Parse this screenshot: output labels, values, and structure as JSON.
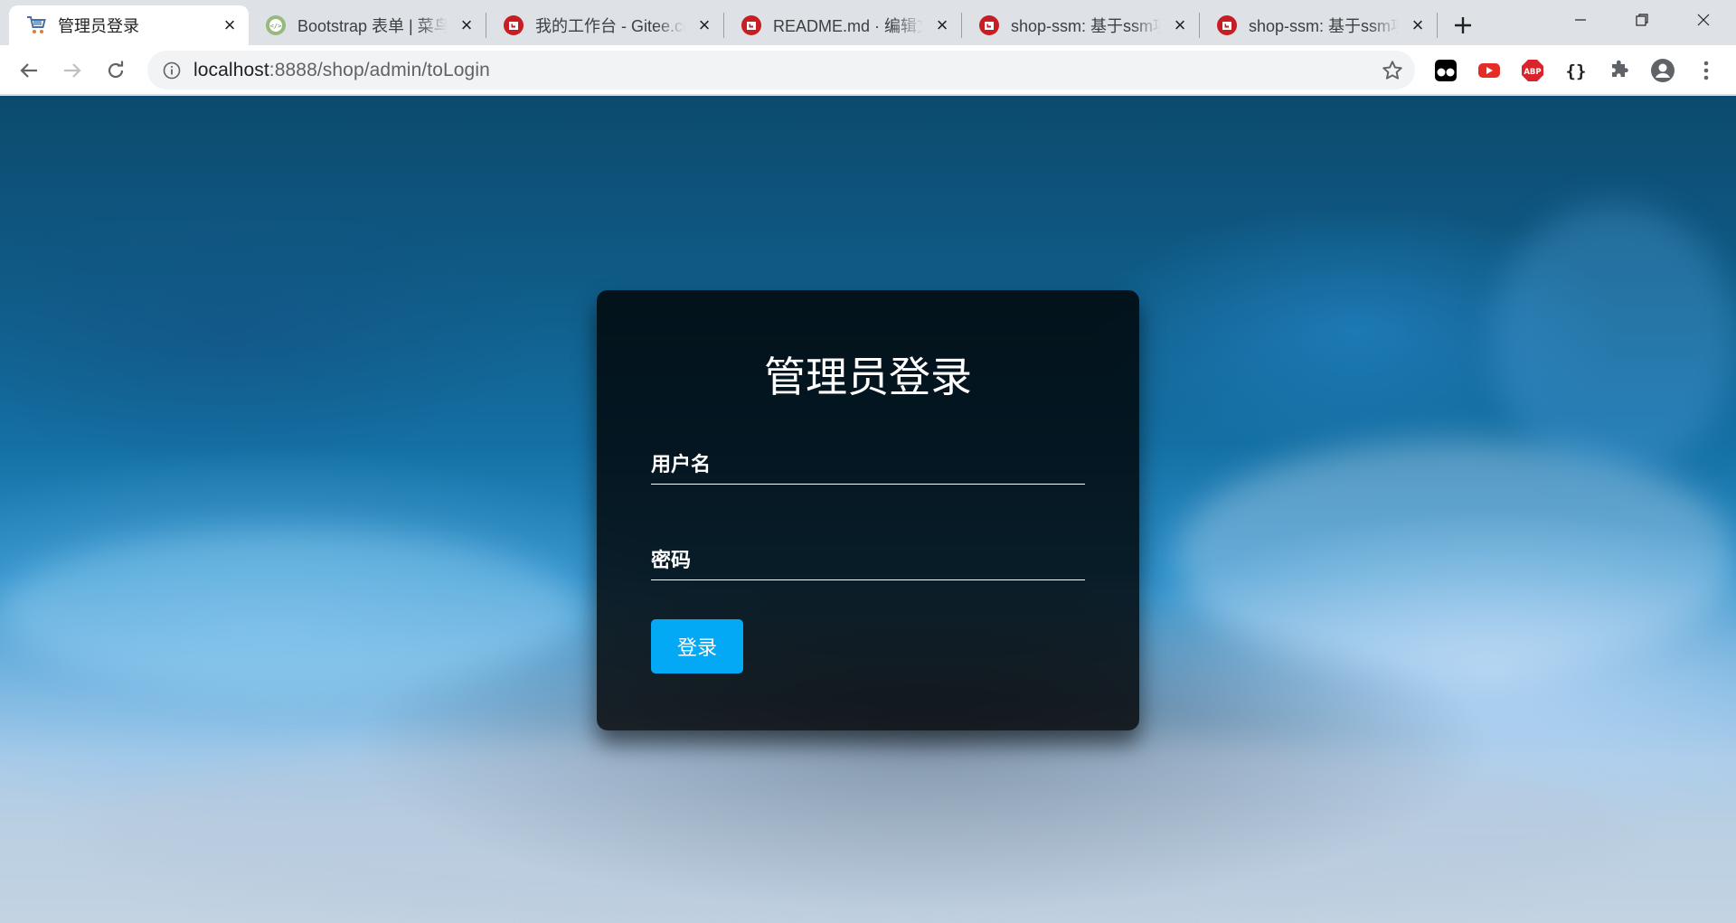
{
  "browser": {
    "tabs": [
      {
        "title": "管理员登录",
        "favicon": "cart-icon",
        "active": true
      },
      {
        "title": "Bootstrap 表单 | 菜鸟教程",
        "favicon": "runoob-icon",
        "active": false
      },
      {
        "title": "我的工作台 - Gitee.com",
        "favicon": "gitee-icon",
        "active": false
      },
      {
        "title": "README.md · 编辑文件",
        "favicon": "gitee-icon",
        "active": false
      },
      {
        "title": "shop-ssm: 基于ssm项目",
        "favicon": "gitee-icon",
        "active": false
      },
      {
        "title": "shop-ssm: 基于ssm项目",
        "favicon": "gitee-icon",
        "active": false
      }
    ],
    "address": {
      "host": "localhost",
      "path": ":8888/shop/admin/toLogin"
    },
    "extensions": [
      "tampermonkey-icon",
      "youtube-icon",
      "adblock-plus-icon",
      "json-viewer-icon",
      "puzzle-icon",
      "account-icon",
      "menu-dots-icon"
    ]
  },
  "login": {
    "title": "管理员登录",
    "username_label": "用户名",
    "password_label": "密码",
    "submit_label": "登录"
  },
  "colors": {
    "button": "#03a9f4",
    "card_bg": "rgba(0,0,0,0.8)"
  }
}
